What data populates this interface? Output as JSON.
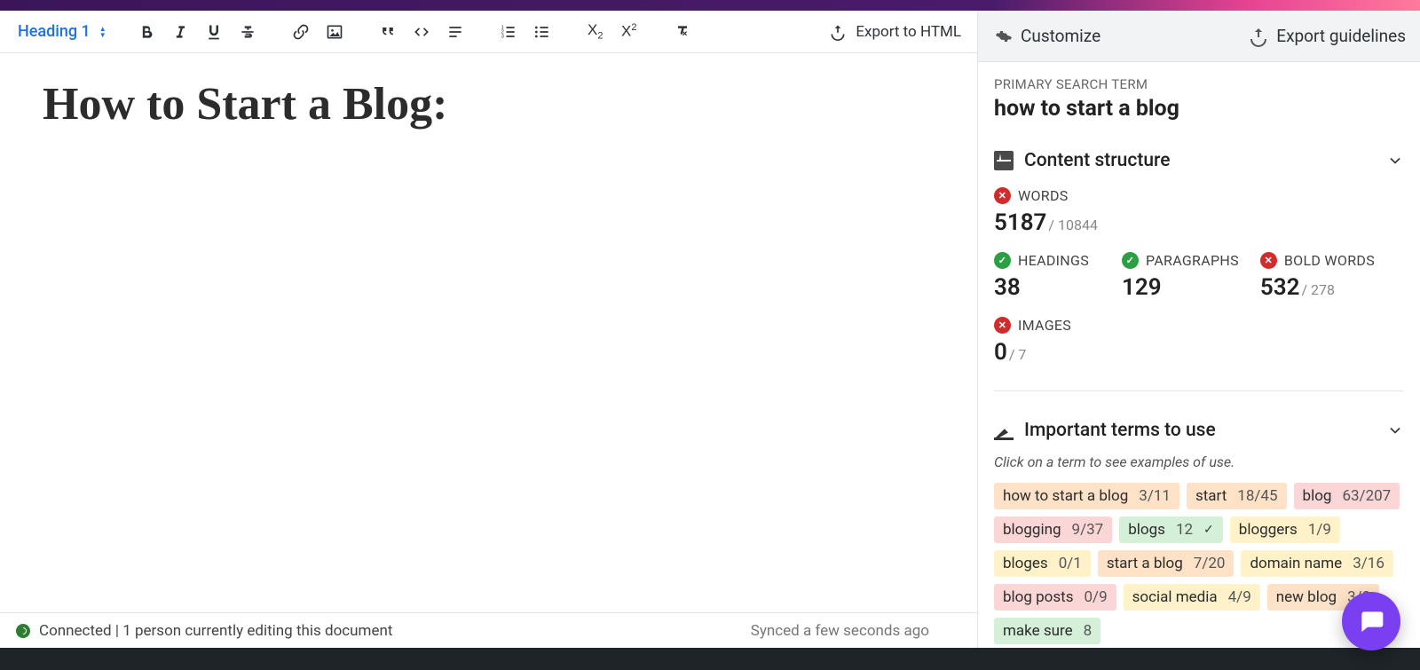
{
  "toolbar": {
    "heading_label": "Heading 1",
    "export_label": "Export to HTML"
  },
  "document": {
    "title": "How to Start a Blog:"
  },
  "status": {
    "connected": "Connected | 1 person currently editing this document",
    "synced": "Synced a few seconds ago"
  },
  "sidebar": {
    "customize": "Customize",
    "export_guidelines": "Export guidelines",
    "primary_label": "PRIMARY SEARCH TERM",
    "primary_term": "how to start a blog",
    "structure": {
      "title": "Content structure",
      "words": {
        "label": "WORDS",
        "value": "5187",
        "target": "/ 10844",
        "status": "bad"
      },
      "headings": {
        "label": "HEADINGS",
        "value": "38",
        "status": "ok"
      },
      "paragraphs": {
        "label": "PARAGRAPHS",
        "value": "129",
        "status": "ok"
      },
      "bold": {
        "label": "BOLD WORDS",
        "value": "532",
        "target": "/ 278",
        "status": "bad"
      },
      "images": {
        "label": "IMAGES",
        "value": "0",
        "target": "/ 7",
        "status": "bad"
      }
    },
    "terms": {
      "title": "Important terms to use",
      "hint": "Click on a term to see examples of use.",
      "items": [
        {
          "name": "how to start a blog",
          "ratio": "3/11",
          "tone": "orange"
        },
        {
          "name": "start",
          "ratio": "18/45",
          "tone": "orange"
        },
        {
          "name": "blog",
          "ratio": "63/207",
          "tone": "red"
        },
        {
          "name": "blogging",
          "ratio": "9/37",
          "tone": "red"
        },
        {
          "name": "blogs",
          "ratio": "12",
          "tone": "green",
          "check": true
        },
        {
          "name": "bloggers",
          "ratio": "1/9",
          "tone": "yellow"
        },
        {
          "name": "bloges",
          "ratio": "0/1",
          "tone": "yellow"
        },
        {
          "name": "start a blog",
          "ratio": "7/20",
          "tone": "orange"
        },
        {
          "name": "domain name",
          "ratio": "3/16",
          "tone": "yellow"
        },
        {
          "name": "blog posts",
          "ratio": "0/9",
          "tone": "red"
        },
        {
          "name": "social media",
          "ratio": "4/9",
          "tone": "yellow"
        },
        {
          "name": "new blog",
          "ratio": "3/8",
          "tone": "orange"
        },
        {
          "name": "make sure",
          "ratio": "8",
          "tone": "green"
        }
      ]
    }
  }
}
